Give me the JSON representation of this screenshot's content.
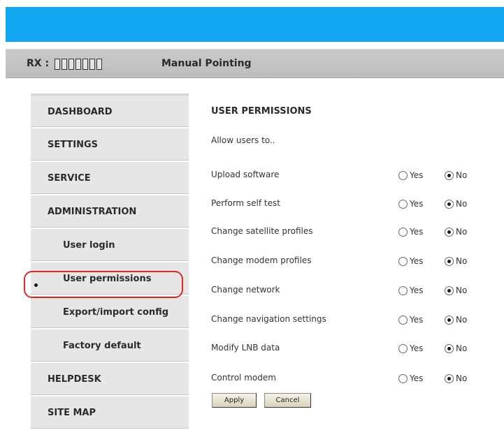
{
  "header": {
    "rx_label": "RX :",
    "mode_label": "Manual Pointing",
    "brand_color": "#13a6f0"
  },
  "sidebar": {
    "items": [
      {
        "label": "DASHBOARD"
      },
      {
        "label": "SETTINGS"
      },
      {
        "label": "SERVICE"
      },
      {
        "label": "ADMINISTRATION"
      },
      {
        "label": "User login"
      },
      {
        "label": "User permissions",
        "selected": true
      },
      {
        "label": "Export/import config"
      },
      {
        "label": "Factory default"
      },
      {
        "label": "HELPDESK"
      },
      {
        "label": "SITE MAP"
      }
    ],
    "highlight_color": "#e0252b"
  },
  "main": {
    "title": "USER PERMISSIONS",
    "subtitle": "Allow users to..",
    "yes_label": "Yes",
    "no_label": "No",
    "permissions": [
      {
        "label": "Upload software",
        "value": "No"
      },
      {
        "label": "Perform self test",
        "value": "No"
      },
      {
        "label": "Change satellite profiles",
        "value": "No"
      },
      {
        "label": "Change modem profiles",
        "value": "No"
      },
      {
        "label": "Change network",
        "value": "No"
      },
      {
        "label": "Change navigation settings",
        "value": "No"
      },
      {
        "label": "Modify LNB data",
        "value": "No"
      },
      {
        "label": "Control modem",
        "value": "No"
      }
    ],
    "apply_label": "Apply",
    "cancel_label": "Cancel"
  }
}
